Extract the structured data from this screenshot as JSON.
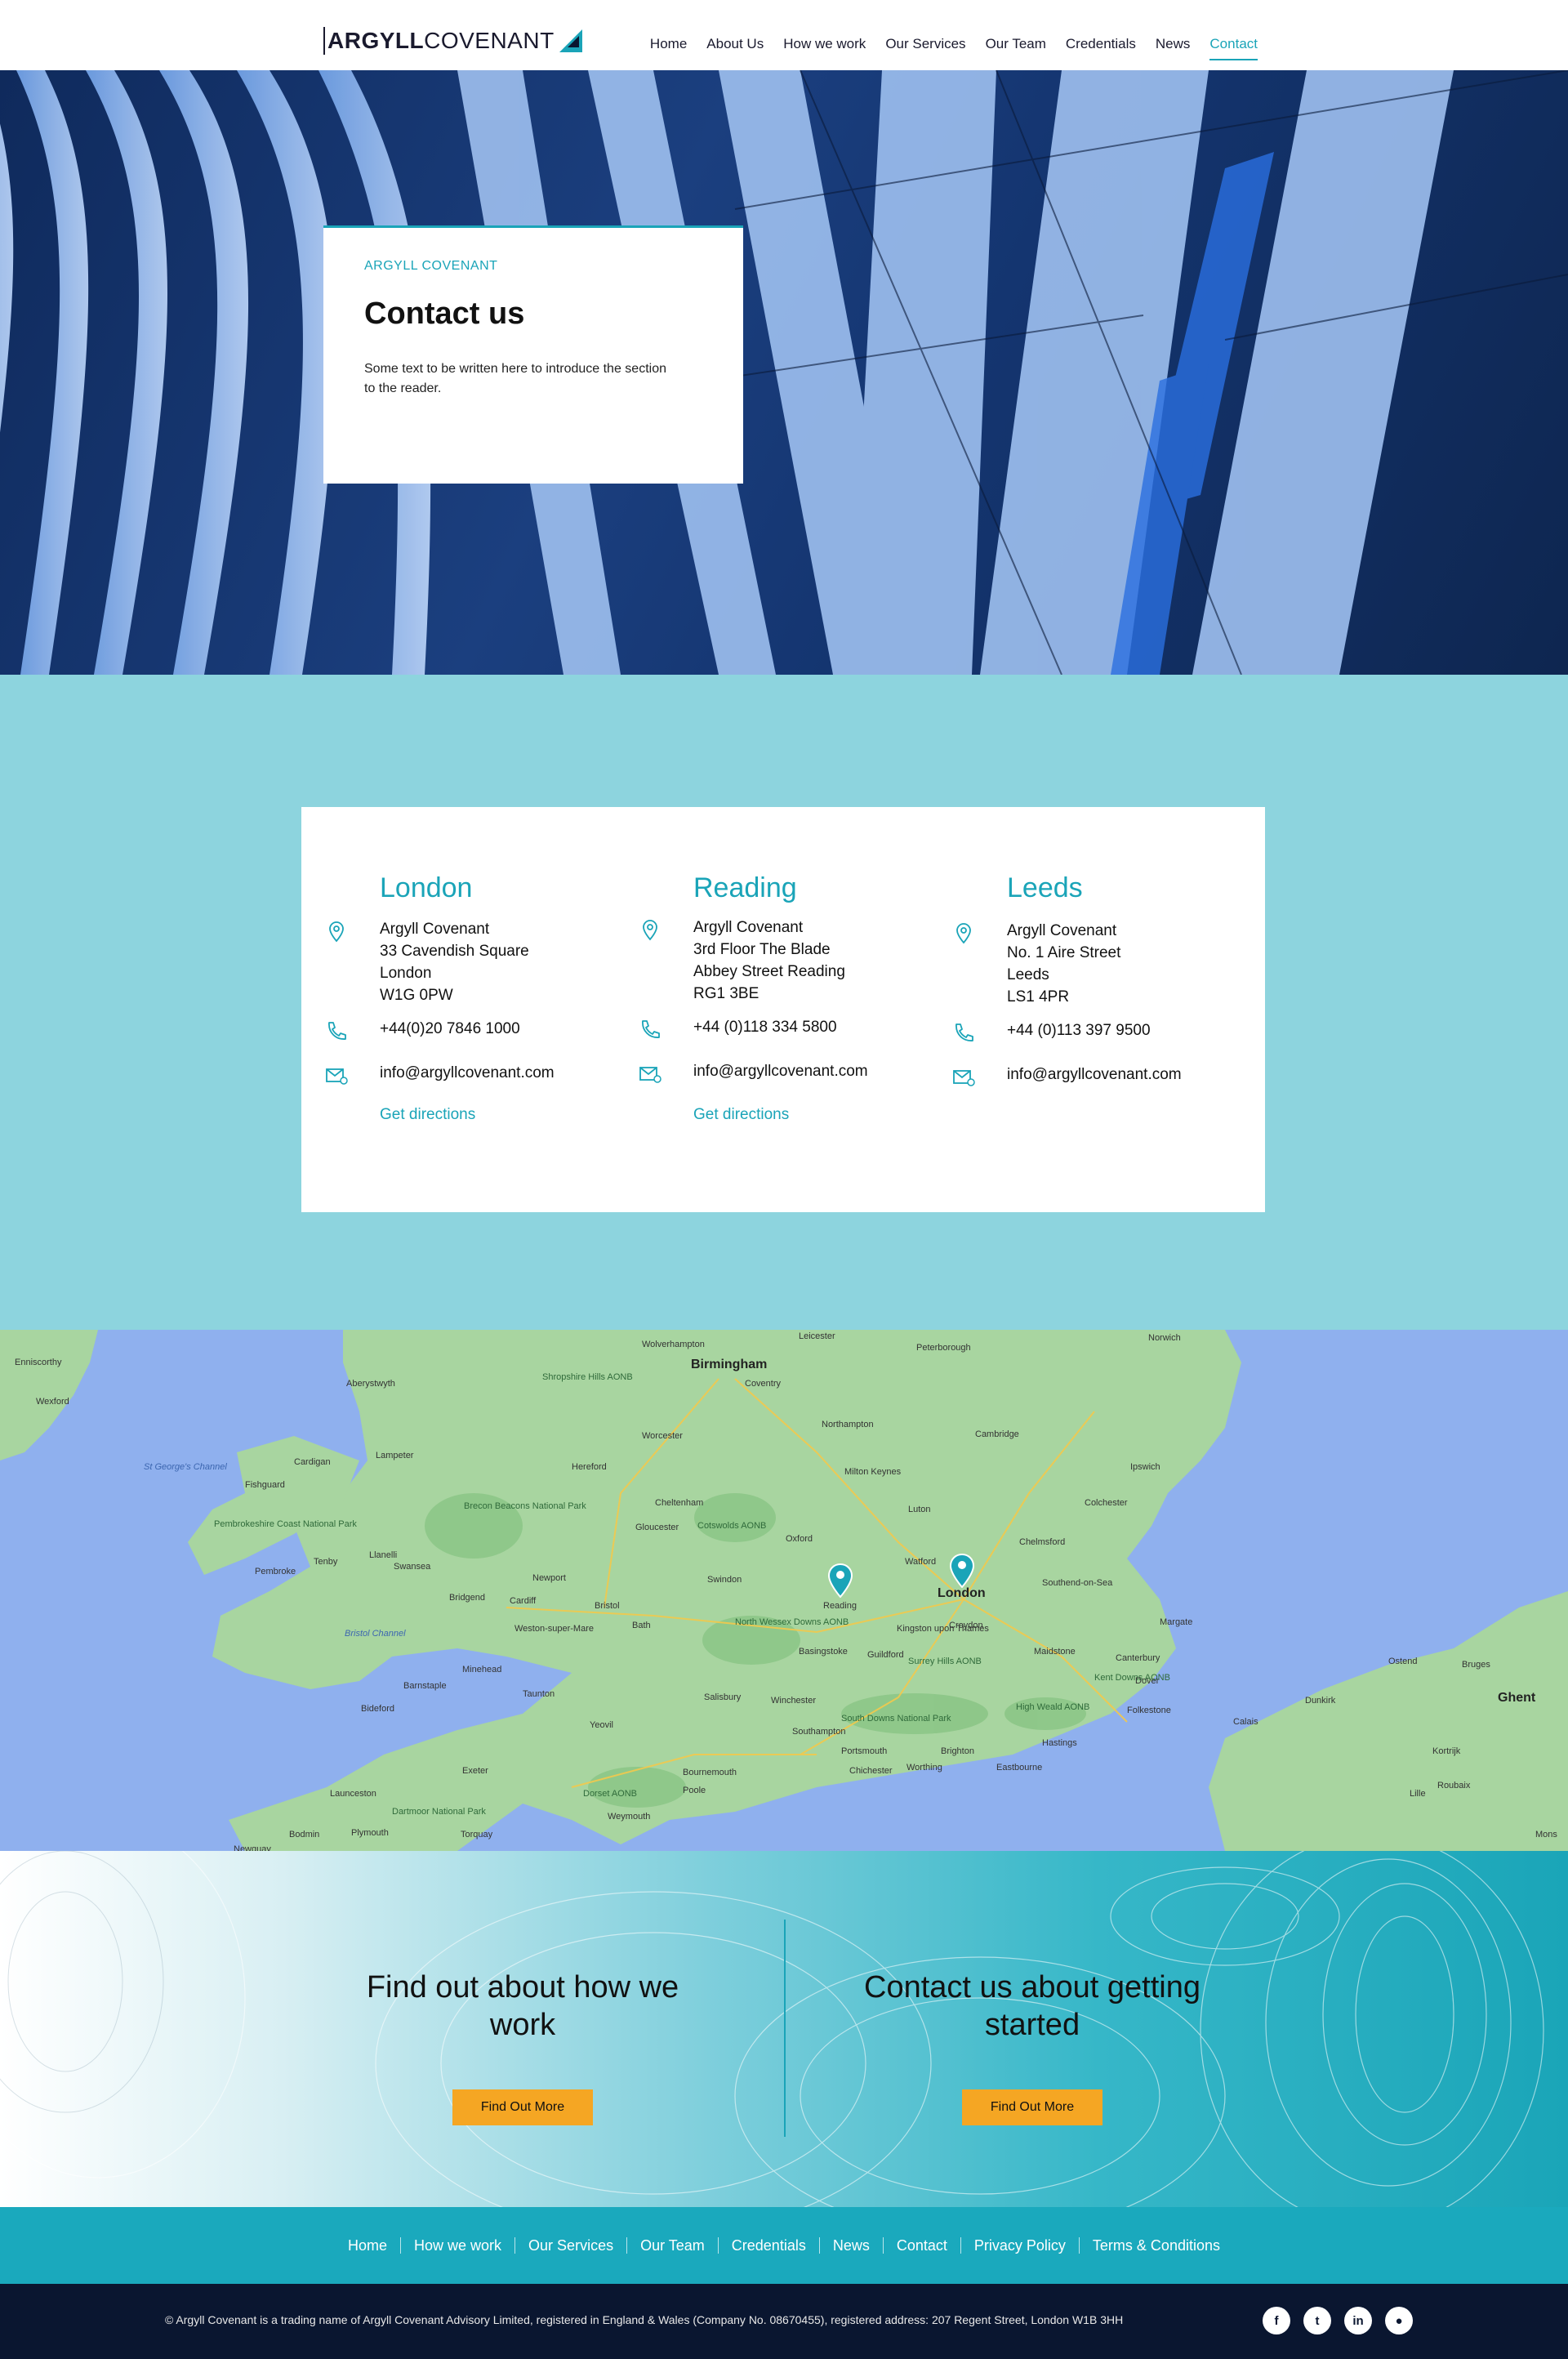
{
  "header": {
    "logo_bold": "ARGYLL",
    "logo_light": "COVENANT",
    "nav": [
      {
        "label": "Home"
      },
      {
        "label": "About Us"
      },
      {
        "label": "How we work"
      },
      {
        "label": "Our Services"
      },
      {
        "label": "Our Team"
      },
      {
        "label": "Credentials"
      },
      {
        "label": "News"
      },
      {
        "label": "Contact"
      }
    ],
    "active_nav": "Contact"
  },
  "hero": {
    "eyebrow": "ARGYLL COVENANT",
    "title": "Contact us",
    "text": "Some text to be written here to introduce the section to the reader."
  },
  "offices": [
    {
      "city": "London",
      "address_lines": [
        "Argyll Covenant",
        "33 Cavendish Square",
        "London",
        "W1G 0PW"
      ],
      "phone": "+44(0)20 7846 1000",
      "email": "info@argyllcovenant.com",
      "directions": "Get directions"
    },
    {
      "city": "Reading",
      "address_lines": [
        "Argyll Covenant",
        "3rd Floor The Blade",
        "Abbey Street Reading",
        "RG1 3BE"
      ],
      "phone": "+44 (0)118 334 5800",
      "email": "info@argyllcovenant.com",
      "directions": "Get directions"
    },
    {
      "city": "Leeds",
      "address_lines": [
        "Argyll Covenant",
        "No. 1 Aire Street",
        "Leeds",
        "LS1 4PR"
      ],
      "phone": "+44 (0)113 397 9500",
      "email": "info@argyllcovenant.com"
    }
  ],
  "map": {
    "labels": [
      "Wolverhampton",
      "Leicester",
      "Peterborough",
      "Norwich",
      "Birmingham",
      "Coventry",
      "Cambridge",
      "Ipswich",
      "Northampton",
      "Milton Keynes",
      "Worcester",
      "Hereford",
      "Cheltenham",
      "Gloucester",
      "Oxford",
      "Luton",
      "Colchester",
      "Chelmsford",
      "Swansea",
      "Cardiff",
      "Newport",
      "Bristol",
      "Swindon",
      "Reading",
      "London",
      "Southend-on-Sea",
      "Bath",
      "Basingstoke",
      "Croydon",
      "Margate",
      "Maidstone",
      "Dover",
      "Southampton",
      "Portsmouth",
      "Brighton",
      "Eastbourne",
      "Hastings",
      "Exeter",
      "Bournemouth",
      "Poole",
      "Plymouth",
      "Torquay",
      "Bruges",
      "Ghent",
      "Lille",
      "Calais",
      "Dunkirk",
      "Ostend",
      "Kortrijk",
      "Roubaix",
      "Mons",
      "Wexford",
      "Enniscorthy",
      "Aberystwyth",
      "Lampeter",
      "Cardigan",
      "Fishguard",
      "Pembroke",
      "Tenby",
      "Llanelli",
      "Bridgend",
      "Weston-super-Mare",
      "Barnstaple",
      "Bideford",
      "Minehead",
      "Taunton",
      "Yeovil",
      "Salisbury",
      "Winchester",
      "Worthing",
      "Chichester",
      "Folkestone",
      "Canterbury",
      "Bodmin",
      "Launceston",
      "Newquay",
      "Weymouth",
      "Watford",
      "Kingston upon Thames",
      "Guildford"
    ],
    "seas": [
      "Bristol Channel",
      "St George's Channel"
    ],
    "parks": [
      "Brecon Beacons National Park",
      "Pembrokeshire Coast National Park",
      "Cotswolds AONB",
      "North Wessex Downs AONB",
      "South Downs National Park",
      "High Weald AONB",
      "Kent Downs AONB",
      "Surrey Hills AONB",
      "Dorset AONB",
      "Dartmoor National Park",
      "Shropshire Hills AONB"
    ],
    "pins": [
      "Reading",
      "London"
    ]
  },
  "cta": {
    "left_title": "Find out about how we work",
    "left_button": "Find Out More",
    "right_title": "Contact us about getting started",
    "right_button": "Find Out More"
  },
  "footer": {
    "links": [
      "Home",
      "How we work",
      "Our Services",
      "Our Team",
      "Credentials",
      "News",
      "Contact",
      "Privacy Policy",
      "Terms & Conditions"
    ],
    "copyright": "© Argyll Covenant is a trading name of Argyll Covenant Advisory Limited, registered in England & Wales (Company No. 08670455), registered address: 207 Regent Street, London W1B 3HH",
    "socials": [
      {
        "name": "facebook-icon",
        "glyph": "f"
      },
      {
        "name": "twitter-icon",
        "glyph": "t"
      },
      {
        "name": "linkedin-icon",
        "glyph": "in"
      },
      {
        "name": "rss-icon",
        "glyph": "●"
      }
    ]
  },
  "colors": {
    "accent": "#1aa4b8",
    "offices_bg": "#8dd4de",
    "button": "#f5a623",
    "footer_bottom": "#0a1630"
  }
}
